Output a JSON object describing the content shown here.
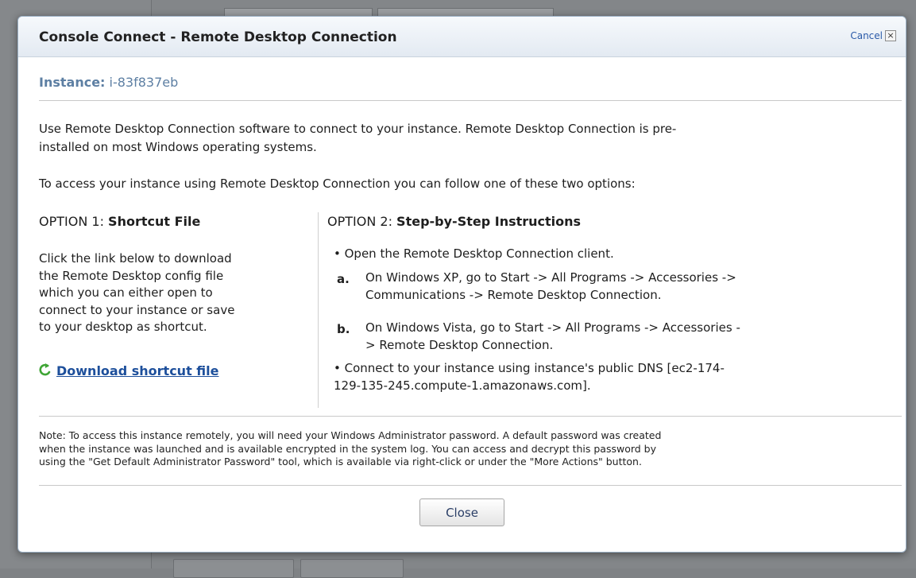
{
  "dialog": {
    "title": "Console Connect - Remote Desktop Connection",
    "cancel_label": "Cancel",
    "cancel_icon": "close-icon",
    "instance_label": "Instance:",
    "instance_id": "i-83f837eb",
    "intro_line1": "Use Remote Desktop Connection software to connect to your instance. Remote Desktop Connection is pre-",
    "intro_line2": "installed on most Windows operating systems.",
    "options_intro": "To access your instance using Remote Desktop Connection you can follow one of these two options:",
    "option1": {
      "prefix": "OPTION 1:",
      "title": "Shortcut File",
      "text_lines": [
        "Click the link below to download",
        "the Remote Desktop config file",
        "which you can either open to",
        "connect to your instance or save",
        "to your desktop as shortcut."
      ],
      "download_icon": "refresh-arrow-icon",
      "download_label": "Download shortcut file"
    },
    "option2": {
      "prefix": "OPTION 2:",
      "title": "Step-by-Step Instructions",
      "bullet1": "• Open the Remote Desktop Connection client.",
      "step_a_letter": "a.",
      "step_a_line1": "On Windows XP, go to Start -> All Programs -> Accessories ->",
      "step_a_line2": "Communications -> Remote Desktop Connection.",
      "step_b_letter": "b.",
      "step_b_line1": "On Windows Vista, go to Start -> All Programs -> Accessories -",
      "step_b_line2": "> Remote Desktop Connection.",
      "bullet2_line1": "• Connect to your instance using instance's public DNS [ec2-174-",
      "bullet2_line2": "129-135-245.compute-1.amazonaws.com]."
    },
    "note_lines": [
      "Note: To access this instance remotely, you will need your Windows Administrator password. A default password was created",
      "when the instance was launched and is available encrypted in the system log. You can access and decrypt this password by",
      "using the \"Get Default Administrator Password\" tool, which is available via right-click or under the \"More Actions\" button."
    ],
    "close_label": "Close"
  },
  "colors": {
    "link": "#1d4f9b",
    "instance": "#5d7fa3",
    "header_bg": "#e3eaf2"
  }
}
